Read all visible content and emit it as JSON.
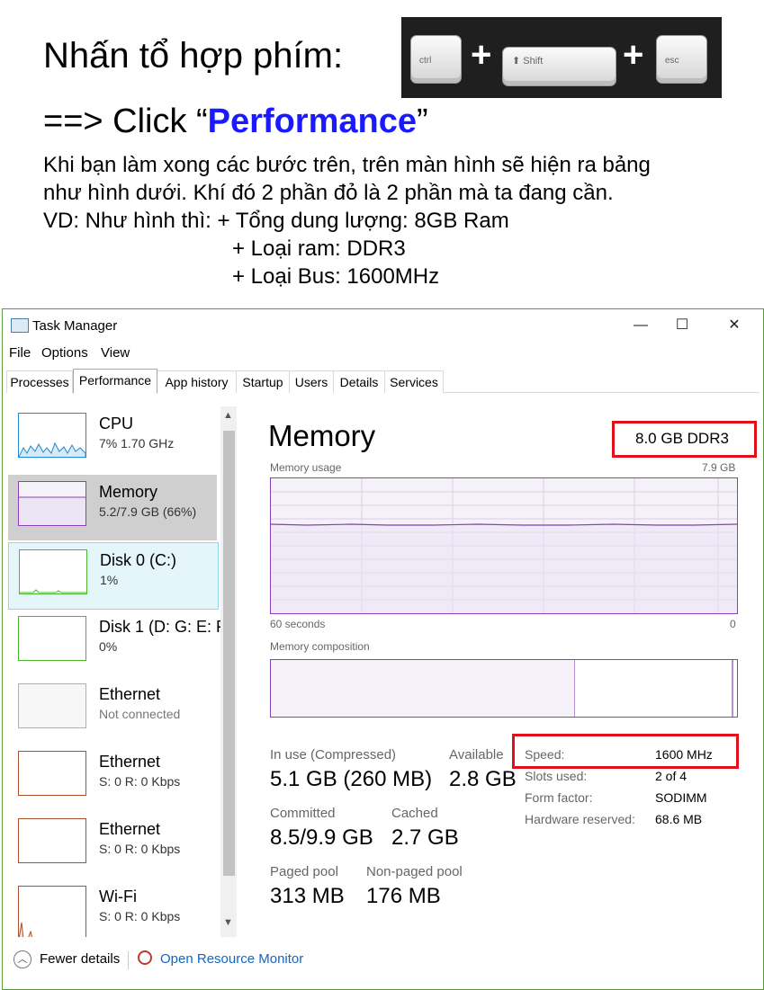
{
  "instructions": {
    "line1": "Nhấn tổ hợp phím:",
    "keys": [
      "ctrl",
      "Shift",
      "esc"
    ],
    "plus": "+",
    "click_prefix": "==> Click “",
    "click_target": "Performance",
    "click_suffix": "”",
    "para1": "Khi bạn làm xong các bước trên, trên màn hình sẽ hiện ra bảng",
    "para2": "như hình dưới. Khí đó 2 phần đỏ là 2 phần mà ta đang cần.",
    "para3": "VD: Như hình thì: + Tổng dung lượng: 8GB Ram",
    "para4": "+  Loại ram: DDR3",
    "para5": "+  Loại Bus: 1600MHz"
  },
  "window": {
    "title": "Task Manager",
    "menu": [
      "File",
      "Options",
      "View"
    ],
    "tabs": [
      "Processes",
      "Performance",
      "App history",
      "Startup",
      "Users",
      "Details",
      "Services"
    ],
    "active_tab": "Performance",
    "controls": {
      "minimize": "—",
      "maximize": "☐",
      "close": "✕"
    }
  },
  "sidebar": {
    "items": [
      {
        "name": "CPU",
        "sub": "7% 1.70 GHz",
        "color": "#1e8ad6"
      },
      {
        "name": "Memory",
        "sub": "5.2/7.9 GB (66%)",
        "color": "#8b3fb8"
      },
      {
        "name": "Disk 0 (C:)",
        "sub": "1%",
        "color": "#4cb82f"
      },
      {
        "name": "Disk 1 (D: G: E: F",
        "sub": "0%",
        "color": "#4cb82f"
      },
      {
        "name": "Ethernet",
        "sub": "Not connected",
        "color": "#b0b0b0"
      },
      {
        "name": "Ethernet",
        "sub": "S: 0 R: 0 Kbps",
        "color": "#a7522a"
      },
      {
        "name": "Ethernet",
        "sub": "S: 0 R: 0 Kbps",
        "color": "#a7522a"
      },
      {
        "name": "Wi-Fi",
        "sub": "S: 0 R: 0 Kbps",
        "color": "#a7522a"
      }
    ]
  },
  "main": {
    "title": "Memory",
    "total_label": "8.0 GB DDR3",
    "usage_label": "Memory usage",
    "usage_max": "7.9 GB",
    "time_label": "60 seconds",
    "time_end": "0",
    "composition_label": "Memory composition",
    "stats": {
      "in_use_label": "In use (Compressed)",
      "in_use_value": "5.1 GB (260 MB)",
      "available_label": "Available",
      "available_value": "2.8 GB",
      "committed_label": "Committed",
      "committed_value": "8.5/9.9 GB",
      "cached_label": "Cached",
      "cached_value": "2.7 GB",
      "paged_label": "Paged pool",
      "paged_value": "313 MB",
      "nonpaged_label": "Non-paged pool",
      "nonpaged_value": "176 MB"
    },
    "specs": [
      {
        "label": "Speed:",
        "value": "1600 MHz"
      },
      {
        "label": "Slots used:",
        "value": "2 of 4"
      },
      {
        "label": "Form factor:",
        "value": "SODIMM"
      },
      {
        "label": "Hardware reserved:",
        "value": "68.6 MB"
      }
    ]
  },
  "footer": {
    "fewer_details": "Fewer details",
    "open_monitor": "Open Resource Monitor"
  },
  "colors": {
    "accent_memory": "#8b3fb8",
    "link": "#1565c0",
    "highlight": "#e0101a"
  }
}
